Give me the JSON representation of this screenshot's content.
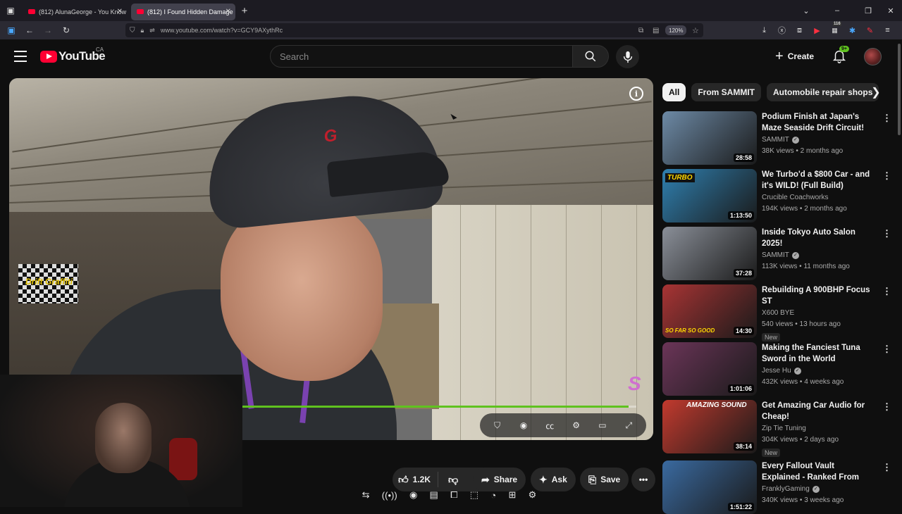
{
  "browser": {
    "tabs": [
      {
        "title": "(812) AlunaGeorge - You Know",
        "active": false
      },
      {
        "title": "(812) I Found Hidden Damage",
        "active": true
      }
    ],
    "new_tab": "+",
    "url": "www.youtube.com/watch?v=GCY9AXythRc",
    "zoom": "120%",
    "ext_badge": "116",
    "window_controls": [
      "⌄",
      "–",
      "❐",
      "✕"
    ]
  },
  "header": {
    "logo_text": "YouTube",
    "country": "CA",
    "search_placeholder": "Search",
    "create_label": "Create",
    "notifications_badge": "9+"
  },
  "player": {
    "flag_text": "Drift Graffiti",
    "progress": 0.98,
    "cap_logo": "G",
    "overlay_letter": "S"
  },
  "actions": {
    "like_count": "1.2K",
    "share_label": "Share",
    "ask_label": "Ask",
    "save_label": "Save"
  },
  "chips": [
    "All",
    "From SAMMIT",
    "Automobile repair shops"
  ],
  "recommendations": [
    {
      "title": "Podium Finish at Japan's Maze Seaside Drift Circuit!",
      "channel": "SAMMIT",
      "verified": true,
      "stats": "38K views • 2 months ago",
      "duration": "28:58",
      "badge": "",
      "thumb_color": "#6d8aa6",
      "thumb_text": ""
    },
    {
      "title": "We Turbo'd a $800 Car - and it's WILD! (Full Build)",
      "channel": "Crucible Coachworks",
      "verified": false,
      "stats": "194K views • 2 months ago",
      "duration": "1:13:50",
      "badge": "",
      "thumb_color": "#2f80b0",
      "thumb_text": "TURBO"
    },
    {
      "title": "Inside Tokyo Auto Salon 2025!",
      "channel": "SAMMIT",
      "verified": true,
      "stats": "113K views • 11 months ago",
      "duration": "37:28",
      "badge": "",
      "thumb_color": "#8a8f98",
      "thumb_text": ""
    },
    {
      "title": "Rebuilding A 900BHP Focus ST",
      "channel": "X600 BYE",
      "verified": false,
      "stats": "540 views • 13 hours ago",
      "duration": "14:30",
      "badge": "New",
      "thumb_color": "#a83434",
      "thumb_text": "SO FAR SO GOOD"
    },
    {
      "title": "Making the Fanciest Tuna Sword in the World",
      "channel": "Jesse Hu",
      "verified": true,
      "stats": "432K views • 4 weeks ago",
      "duration": "1:01:06",
      "badge": "",
      "thumb_color": "#6b3558",
      "thumb_text": ""
    },
    {
      "title": "Get Amazing Car Audio for Cheap!",
      "channel": "Zip Tie Tuning",
      "verified": false,
      "stats": "304K views • 2 days ago",
      "duration": "38:14",
      "badge": "New",
      "thumb_color": "#c23a2e",
      "thumb_text": "AMAZING SOUND"
    },
    {
      "title": "Every Fallout Vault Explained - Ranked From Least To Most ...",
      "channel": "FranklyGaming",
      "verified": true,
      "stats": "340K views • 3 weeks ago",
      "duration": "1:51:22",
      "badge": "",
      "thumb_color": "#3a6aa0",
      "thumb_text": ""
    }
  ]
}
